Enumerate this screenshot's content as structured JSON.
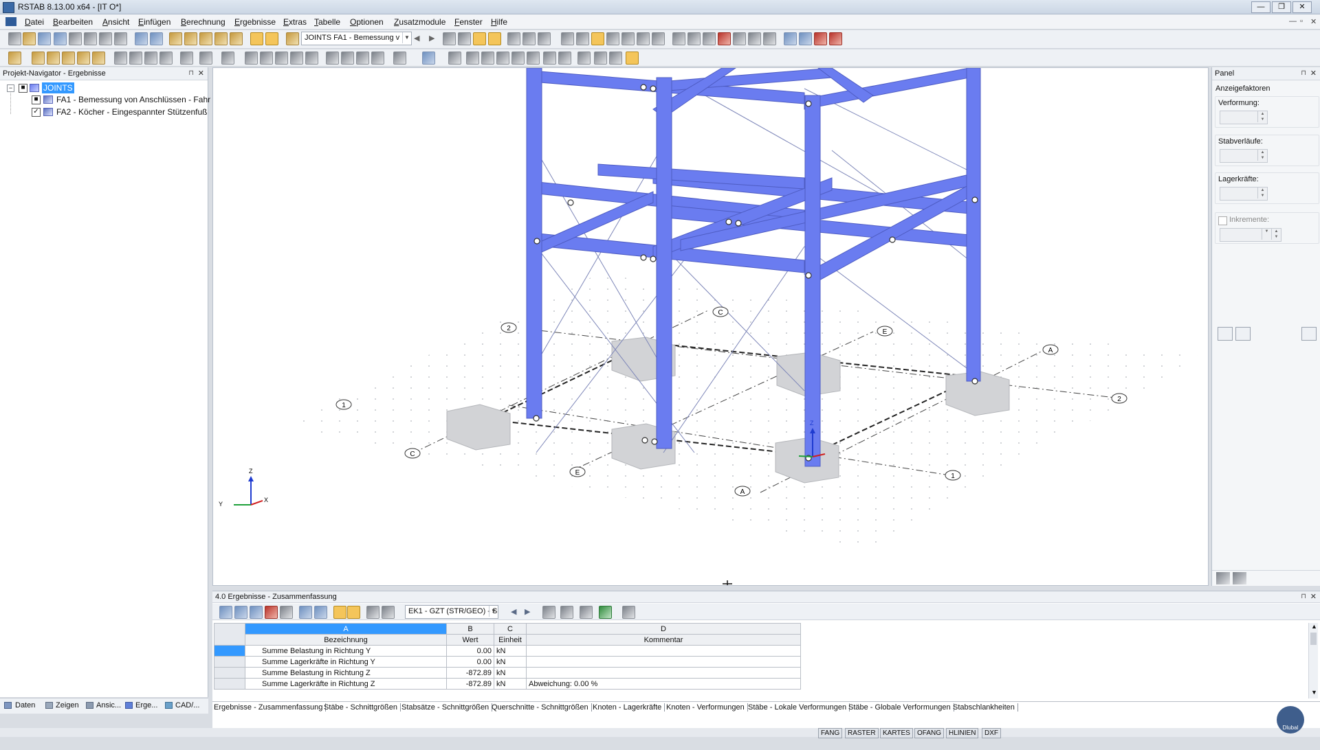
{
  "window": {
    "title": "RSTAB 8.13.00 x64 - [IT O*]",
    "controls": [
      "—",
      "❐",
      "✕"
    ],
    "mdi_controls": [
      "—",
      "▫",
      "✕"
    ]
  },
  "menu": [
    "Datei",
    "Bearbeiten",
    "Ansicht",
    "Einfügen",
    "Berechnung",
    "Ergebnisse",
    "Extras",
    "Tabelle",
    "Optionen",
    "Zusatzmodule",
    "Fenster",
    "Hilfe"
  ],
  "toolbar": {
    "module_combo": "JOINTS FA1 - Bemessung v"
  },
  "navigator": {
    "title": "Projekt-Navigator - Ergebnisse",
    "pin": "⊓",
    "close": "✕",
    "root": "JOINTS",
    "items": [
      {
        "label": "FA1 - Bemessung von Anschlüssen - Fahr",
        "checked": false
      },
      {
        "label": "FA2 - Köcher - Eingespannter Stützenfuß",
        "checked": true
      }
    ],
    "tabs": [
      "Daten",
      "Zeigen",
      "Ansic...",
      "Erge...",
      "CAD/..."
    ]
  },
  "viewport": {
    "grid_labels": [
      "1",
      "2",
      "A",
      "C",
      "E"
    ],
    "axis_labels": {
      "z": "Z",
      "y": "Y",
      "x": "X"
    },
    "local_axis_z": "Z"
  },
  "panel": {
    "title": "Panel",
    "section": "Anzeigefaktoren",
    "fields": [
      "Verformung:",
      "Stabverläufe:",
      "Lagerkräfte:"
    ],
    "increments_label": "Inkremente:"
  },
  "results": {
    "title": "4.0 Ergebnisse - Zusammenfassung",
    "load_combo": "EK1 - GZT (STR/GEO) - S",
    "columns": [
      {
        "letter": "A",
        "label": "Bezeichnung"
      },
      {
        "letter": "B",
        "label": "Wert"
      },
      {
        "letter": "C",
        "label": "Einheit"
      },
      {
        "letter": "D",
        "label": "Kommentar"
      }
    ],
    "rows": [
      {
        "name": "Summe Belastung in Richtung Y",
        "value": "0.00",
        "unit": "kN",
        "comment": ""
      },
      {
        "name": "Summe Lagerkräfte in Richtung Y",
        "value": "0.00",
        "unit": "kN",
        "comment": ""
      },
      {
        "name": "Summe Belastung in Richtung Z",
        "value": "-872.89",
        "unit": "kN",
        "comment": ""
      },
      {
        "name": "Summe Lagerkräfte in Richtung Z",
        "value": "-872.89",
        "unit": "kN",
        "comment": "Abweichung:  0.00 %"
      }
    ],
    "tabs": [
      "Ergebnisse - Zusammenfassung",
      "Stäbe - Schnittgrößen",
      "Stabsätze - Schnittgrößen",
      "Querschnitte - Schnittgrößen",
      "Knoten - Lagerkräfte",
      "Knoten - Verformungen",
      "Stäbe - Lokale Verformungen",
      "Stäbe - Globale Verformungen",
      "Stabschlankheiten"
    ]
  },
  "statusbar": [
    "FANG",
    "RASTER",
    "KARTES",
    "OFANG",
    "HLINIEN",
    "DXF"
  ],
  "logo": "Dlubal",
  "colors": {
    "member": "#6a7cf0",
    "selection": "#3399ff"
  }
}
